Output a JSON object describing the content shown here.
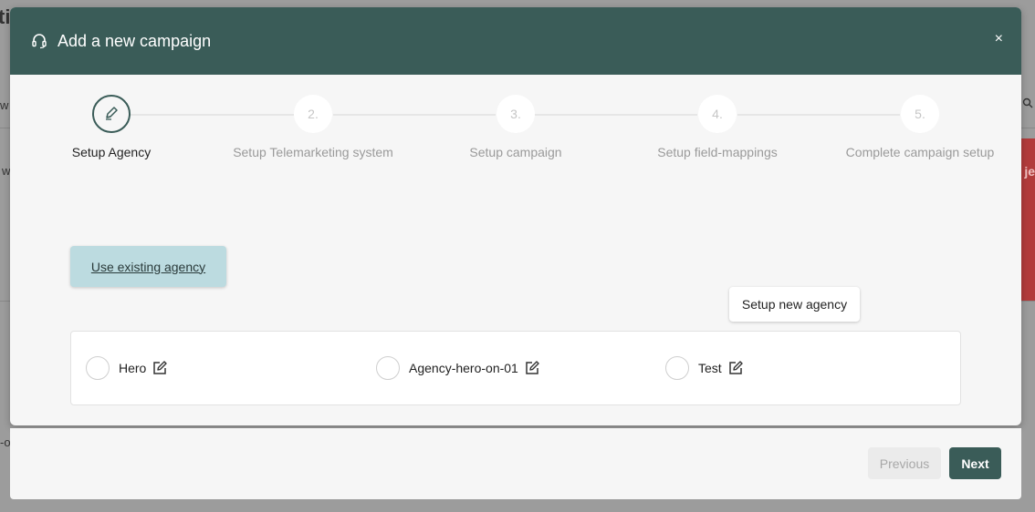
{
  "background": {
    "title_fragment": "ti",
    "row_fragment_1": "w",
    "row_fragment_2": "w",
    "row_fragment_3": "-o",
    "side_fragment": "je"
  },
  "modal": {
    "title": "Add a new campaign",
    "header_icon": "headset-icon",
    "close_label": "×",
    "header_color": "#3a5c58"
  },
  "stepper": {
    "steps": [
      {
        "number": "",
        "label": "Setup Agency",
        "active": true,
        "icon": "pencil-icon"
      },
      {
        "number": "2.",
        "label": "Setup Telemarketing system",
        "active": false
      },
      {
        "number": "3.",
        "label": "Setup campaign",
        "active": false
      },
      {
        "number": "4.",
        "label": "Setup field-mappings",
        "active": false
      },
      {
        "number": "5.",
        "label": "Complete campaign setup",
        "active": false
      }
    ]
  },
  "actions": {
    "use_existing": "Use existing agency",
    "setup_new": "Setup new agency"
  },
  "agencies": [
    {
      "name": "Hero"
    },
    {
      "name": "Agency-hero-on-01"
    },
    {
      "name": "Test"
    }
  ],
  "footer": {
    "previous": "Previous",
    "next": "Next"
  }
}
